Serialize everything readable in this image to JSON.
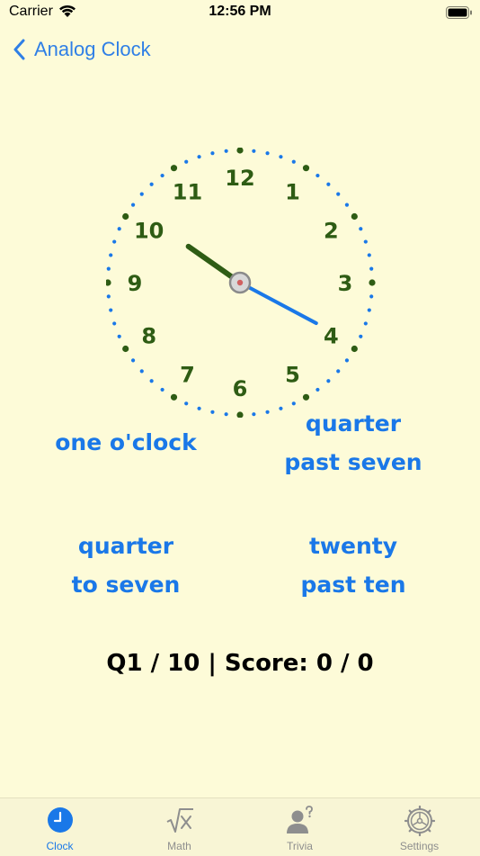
{
  "status_bar": {
    "carrier": "Carrier",
    "time": "12:56 PM"
  },
  "nav": {
    "back_label": "Analog Clock"
  },
  "clock": {
    "numerals": [
      "12",
      "1",
      "2",
      "3",
      "4",
      "5",
      "6",
      "7",
      "8",
      "9",
      "10",
      "11"
    ],
    "hour_hand_angle_deg": -55,
    "minute_hand_angle_deg": 118,
    "colors": {
      "numerals": "#2e5c14",
      "hour_dots": "#2e5c14",
      "minute_dots": "#1a78e8",
      "hour_hand": "#2e5c14",
      "minute_hand": "#1a78e8"
    }
  },
  "answers": [
    {
      "line1": "one o'clock",
      "line2": ""
    },
    {
      "line1": "quarter",
      "line2": "past seven"
    },
    {
      "line1": "quarter",
      "line2": "to seven"
    },
    {
      "line1": "twenty",
      "line2": "past ten"
    }
  ],
  "score": {
    "text": "Q1 / 10 | Score: 0 / 0"
  },
  "tabs": [
    {
      "label": "Clock",
      "icon": "clock-icon",
      "active": true
    },
    {
      "label": "Math",
      "icon": "square-root-icon",
      "active": false
    },
    {
      "label": "Trivia",
      "icon": "person-question-icon",
      "active": false
    },
    {
      "label": "Settings",
      "icon": "gear-icon",
      "active": false
    }
  ],
  "theme": {
    "background": "#fdfbd8",
    "accent": "#1a78e8",
    "tab_inactive": "#8e8e8e"
  }
}
